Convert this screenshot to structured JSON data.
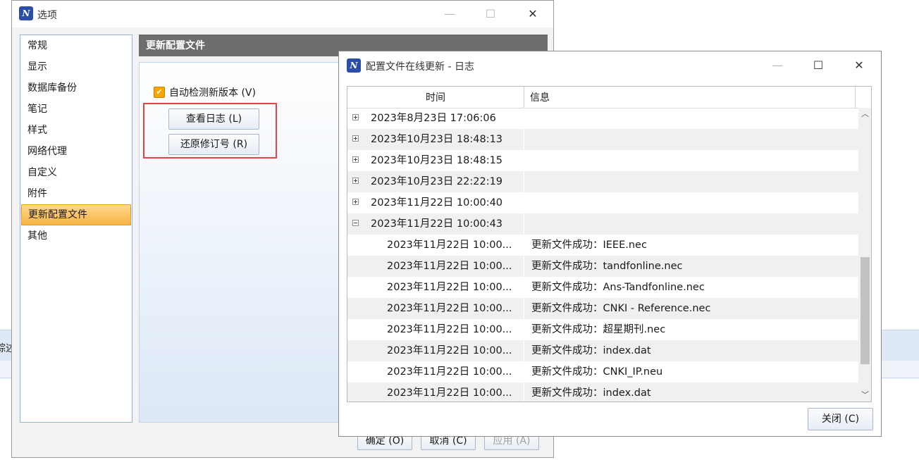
{
  "background": {
    "partial_text": "综述"
  },
  "options_window": {
    "title": "选项",
    "icon_letter": "N",
    "nav_items": [
      "常规",
      "显示",
      "数据库备份",
      "笔记",
      "样式",
      "网络代理",
      "自定义",
      "附件",
      "更新配置文件",
      "其他"
    ],
    "selected_nav": "更新配置文件",
    "panel_title": "更新配置文件",
    "checkbox_label": "自动检测新版本 (V)",
    "checkbox_checked": true,
    "view_log_button": "查看日志 (L)",
    "restore_revision_button": "还原修订号 (R)",
    "ok_button": "确定 (O)",
    "cancel_button": "取消 (C)",
    "apply_button": "应用 (A)"
  },
  "log_window": {
    "title": "配置文件在线更新 - 日志",
    "icon_letter": "N",
    "columns": {
      "time": "时间",
      "info": "信息"
    },
    "rows": [
      {
        "kind": "group",
        "expanded": false,
        "time": "2023年8月23日 17:06:06",
        "info": ""
      },
      {
        "kind": "group",
        "expanded": false,
        "time": "2023年10月23日 18:48:13",
        "info": ""
      },
      {
        "kind": "group",
        "expanded": false,
        "time": "2023年10月23日 18:48:15",
        "info": ""
      },
      {
        "kind": "group",
        "expanded": false,
        "time": "2023年10月23日 22:22:19",
        "info": ""
      },
      {
        "kind": "group",
        "expanded": false,
        "time": "2023年11月22日 10:00:40",
        "info": ""
      },
      {
        "kind": "group",
        "expanded": true,
        "time": "2023年11月22日 10:00:43",
        "info": ""
      },
      {
        "kind": "child",
        "time": "2023年11月22日 10:00...",
        "info": "更新文件成功：IEEE.nec"
      },
      {
        "kind": "child",
        "time": "2023年11月22日 10:00...",
        "info": "更新文件成功：tandfonline.nec"
      },
      {
        "kind": "child",
        "time": "2023年11月22日 10:00...",
        "info": "更新文件成功：Ans-Tandfonline.nec"
      },
      {
        "kind": "child",
        "time": "2023年11月22日 10:00...",
        "info": "更新文件成功：CNKI - Reference.nec"
      },
      {
        "kind": "child",
        "time": "2023年11月22日 10:00...",
        "info": "更新文件成功：超星期刊.nec"
      },
      {
        "kind": "child",
        "time": "2023年11月22日 10:00...",
        "info": "更新文件成功：index.dat"
      },
      {
        "kind": "child",
        "time": "2023年11月22日 10:00...",
        "info": "更新文件成功：CNKI_IP.neu"
      },
      {
        "kind": "child",
        "time": "2023年11月22日 10:00...",
        "info": "更新文件成功：index.dat"
      }
    ],
    "close_button": "关闭 (C)"
  },
  "colors": {
    "highlight_box": "#e24545",
    "selected_nav": "#f7b345",
    "checkbox": "#f7a700"
  }
}
